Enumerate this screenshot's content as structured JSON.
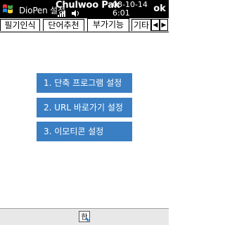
{
  "titlebar": {
    "app_title": "DioPen 설정",
    "user_name": "Chulwoo Pak",
    "date": "08-10-14",
    "time": "6:01",
    "ok_label": "ok",
    "start_icon": "windows-flag-icon",
    "status_icons": [
      "signal-icon",
      "volume-icon"
    ]
  },
  "tabs": [
    {
      "label": "필기인식",
      "active": false
    },
    {
      "label": "단어추천",
      "active": false
    },
    {
      "label": "부가기능",
      "active": true
    },
    {
      "label": "기타",
      "active": false
    }
  ],
  "tab_scroll": {
    "left": "◀",
    "right": "▶"
  },
  "menu": {
    "items": [
      {
        "label": "1. 단축 프로그램 설정"
      },
      {
        "label": "2. URL 바로가기 설정"
      },
      {
        "label": "3. 이모티콘 설정"
      }
    ],
    "button_color": "#3a7fc4"
  },
  "bottombar": {
    "ime_icon": "korean-ime-icon",
    "ime_label": "한"
  }
}
